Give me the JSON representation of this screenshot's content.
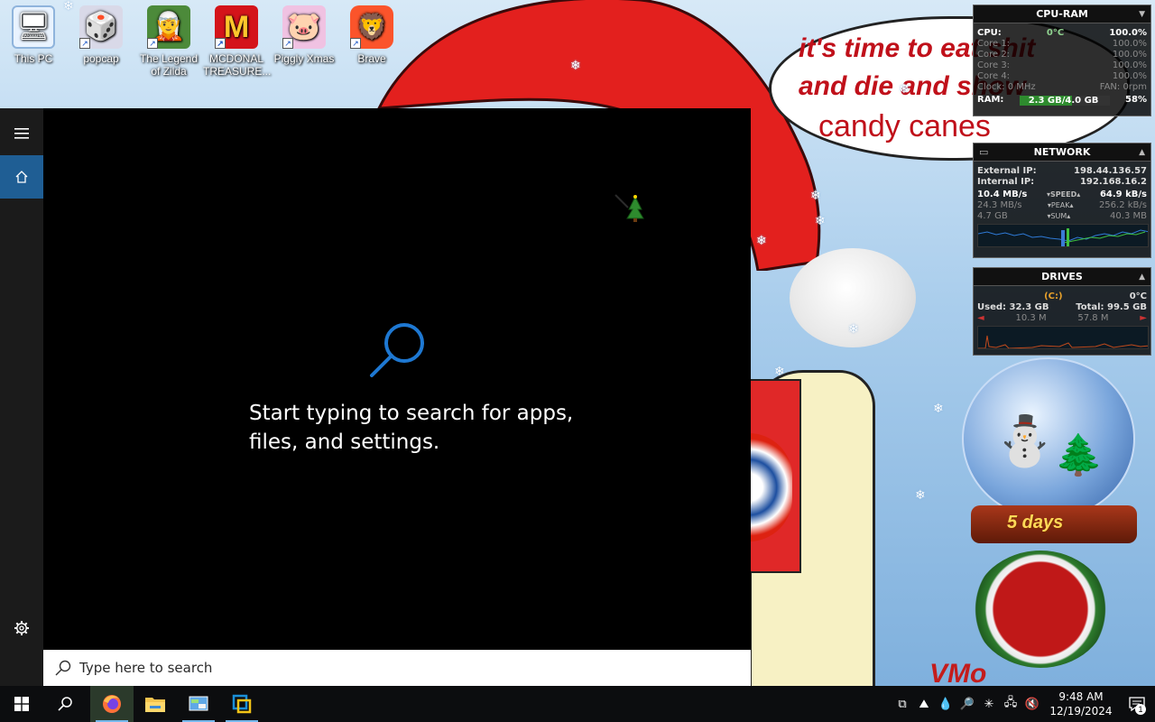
{
  "desktop": {
    "icons": [
      {
        "label": "This PC",
        "icon": "computer-icon"
      },
      {
        "label": "popcap",
        "icon": "popcap-icon"
      },
      {
        "label": "The Legend of Zilda",
        "icon": "zilda-game-icon"
      },
      {
        "label": "MCDONAL TREASURE...",
        "icon": "mcdonalds-icon"
      },
      {
        "label": "Piggly Xmas",
        "icon": "piggly-icon"
      },
      {
        "label": "Brave",
        "icon": "brave-icon"
      }
    ]
  },
  "wallpaper": {
    "bubble_lines": [
      "it's time to eat shit",
      "and die and show",
      "candy canes"
    ],
    "signature": "VMo"
  },
  "widgets": {
    "cpu_ram": {
      "title": "CPU-RAM",
      "cpu_label": "CPU:",
      "cpu_temp": "0°C",
      "cpu_value": "100.0%",
      "cores": [
        {
          "label": "Core 1:",
          "value": "100.0%"
        },
        {
          "label": "Core 2:",
          "value": "100.0%"
        },
        {
          "label": "Core 3:",
          "value": "100.0%"
        },
        {
          "label": "Core 4:",
          "value": "100.0%"
        }
      ],
      "clock": "Clock: 0 MHz",
      "fan": "FAN: 0rpm",
      "ram_label": "RAM:",
      "ram_value": "2.3 GB/4.0 GB",
      "ram_percent_text": "58%",
      "ram_fraction": 0.58
    },
    "network": {
      "title": "NETWORK",
      "external_label": "External IP:",
      "external_ip": "198.44.136.57",
      "internal_label": "Internal IP:",
      "internal_ip": "192.168.16.2",
      "speed_down": "10.4 MB/s",
      "speed_label": "SPEED",
      "speed_up": "64.9 kB/s",
      "peak_down": "24.3 MB/s",
      "peak_label": "PEAK",
      "peak_up": "256.2 kB/s",
      "sum_down": "4.7 GB",
      "sum_label": "SUM",
      "sum_up": "40.3 MB"
    },
    "drives": {
      "title": "DRIVES",
      "drive": "(C:)",
      "temp": "0°C",
      "used": "Used: 32.3 GB",
      "total": "Total: 99.5 GB",
      "read": "10.3 M",
      "write": "57.8 M"
    },
    "countdown": {
      "text": "5 days"
    }
  },
  "start": {
    "hint": "Start typing to search for apps, files, and settings.",
    "search_placeholder": "Type here to search"
  },
  "taskbar": {
    "apps": [
      {
        "name": "firefox",
        "active": true
      },
      {
        "name": "file-explorer",
        "active": false
      },
      {
        "name": "control-panel",
        "active": false
      },
      {
        "name": "virtualbox",
        "active": false
      }
    ],
    "time": "9:48 AM",
    "date": "12/19/2024",
    "notification_count": "1"
  },
  "colors": {
    "accent": "#1f5e94",
    "taskbar": "#0c0d0f",
    "start_bg": "#000000",
    "search_icon_blue": "#1e78d2"
  }
}
